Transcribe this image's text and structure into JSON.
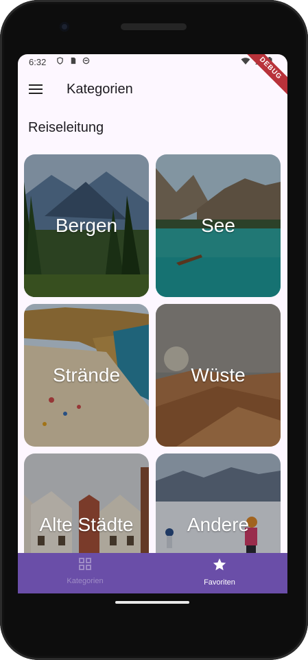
{
  "status": {
    "time": "6:32",
    "debug_banner": "DEBUG"
  },
  "appbar": {
    "title": "Kategorien"
  },
  "section_title": "Reiseleitung",
  "categories": [
    {
      "label": "Bergen"
    },
    {
      "label": "See"
    },
    {
      "label": "Strände"
    },
    {
      "label": "Wüste"
    },
    {
      "label": "Alte Städte"
    },
    {
      "label": "Andere"
    }
  ],
  "bottom_nav": {
    "items": [
      {
        "label": "Kategorien",
        "icon": "grid-icon",
        "selected": false
      },
      {
        "label": "Favoriten",
        "icon": "star-icon",
        "selected": true
      }
    ]
  },
  "colors": {
    "nav_bg": "#6a4ea8",
    "screen_bg": "#fdf7ff"
  }
}
